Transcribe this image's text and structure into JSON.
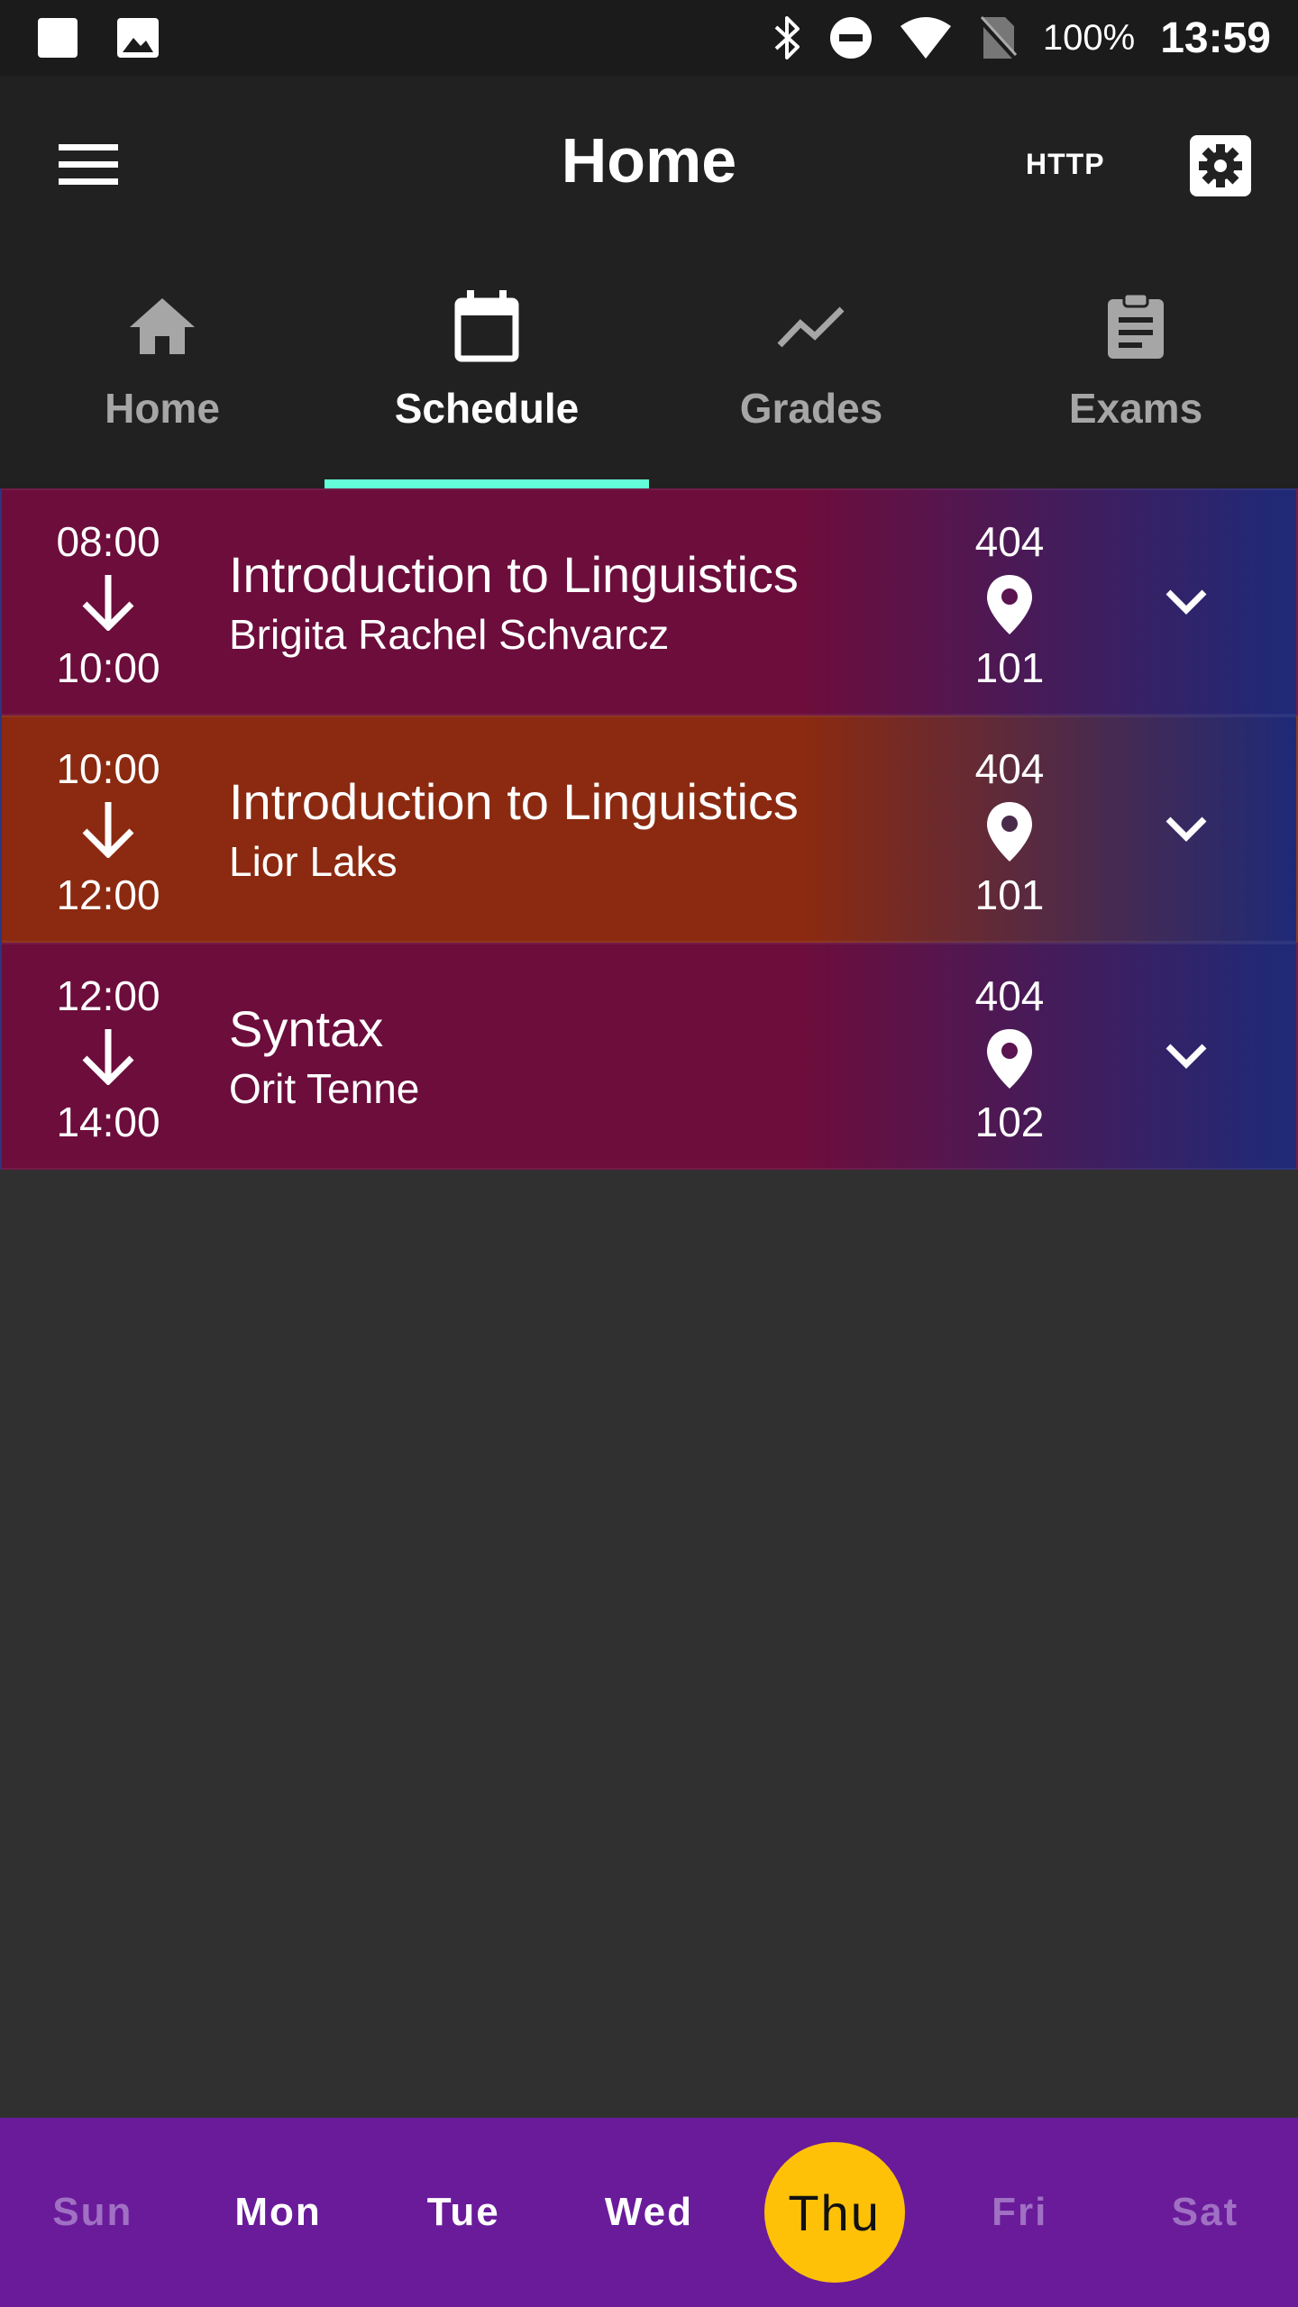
{
  "status_bar": {
    "battery": "100%",
    "time": "13:59"
  },
  "app_bar": {
    "title": "Home",
    "http_label": "HTTP"
  },
  "tabs": [
    {
      "label": "Home",
      "icon": "home-icon",
      "active": false
    },
    {
      "label": "Schedule",
      "icon": "calendar-icon",
      "active": true
    },
    {
      "label": "Grades",
      "icon": "trending-icon",
      "active": false
    },
    {
      "label": "Exams",
      "icon": "clipboard-icon",
      "active": false
    }
  ],
  "lessons": [
    {
      "start": "08:00",
      "end": "10:00",
      "name": "Introduction to Linguistics",
      "teacher": "Brigita Rachel Schvarcz",
      "building": "404",
      "room": "101",
      "color": "#6c0d3c"
    },
    {
      "start": "10:00",
      "end": "12:00",
      "name": "Introduction to Linguistics",
      "teacher": "Lior Laks",
      "building": "404",
      "room": "101",
      "color": "#8b2a10"
    },
    {
      "start": "12:00",
      "end": "14:00",
      "name": "Syntax",
      "teacher": "Orit Tenne",
      "building": "404",
      "room": "102",
      "color": "#6c0d3c"
    }
  ],
  "days": [
    {
      "label": "Sun",
      "state": "dim"
    },
    {
      "label": "Mon",
      "state": "normal"
    },
    {
      "label": "Tue",
      "state": "normal"
    },
    {
      "label": "Wed",
      "state": "normal"
    },
    {
      "label": "Thu",
      "state": "selected"
    },
    {
      "label": "Fri",
      "state": "dim"
    },
    {
      "label": "Sat",
      "state": "dim"
    }
  ],
  "colors": {
    "tab_indicator": "#64ffda",
    "day_bar": "#6a1b9a",
    "day_selected": "#ffc107",
    "lesson_end_blue": "#1e2a78"
  }
}
